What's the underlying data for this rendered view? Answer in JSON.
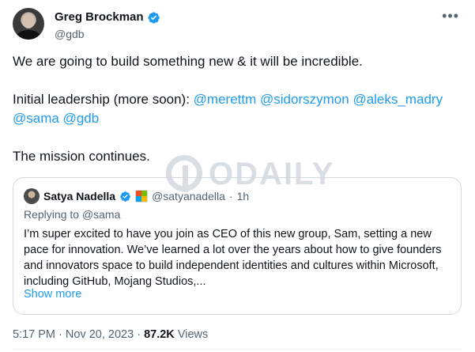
{
  "author": {
    "name": "Greg Brockman",
    "handle": "@gdb"
  },
  "icons": {
    "more": "more-options-icon",
    "verified": "verified-badge-icon"
  },
  "tweet": {
    "line1": "We are going to build something new & it will be incredible.",
    "leadership_prefix": "Initial leadership (more soon): ",
    "mentions": [
      "@merettm",
      "@sidorszymon",
      "@aleks_madry",
      "@sama",
      "@gdb"
    ],
    "line3": "The mission continues."
  },
  "quoted": {
    "name": "Satya Nadella",
    "handle": "@satyanadella",
    "separator": "·",
    "time": "1h",
    "replying_to": "Replying to @sama",
    "text": "I’m super excited to have you join as CEO of this new group, Sam, setting a new pace for innovation. We’ve learned a lot over the years about how to give founders and innovators space to build independent identities and cultures within Microsoft, including GitHub, Mojang Studios,...",
    "show_more": "Show more"
  },
  "meta": {
    "time": "5:17 PM",
    "date": "Nov 20, 2023",
    "separator": "·",
    "views_count": "87.2K",
    "views_label": "Views"
  },
  "watermark": {
    "text": "ODAILY"
  },
  "colors": {
    "link": "#1d9bf0",
    "text": "#0f1419",
    "secondary": "#536471",
    "border": "#cfd9de"
  }
}
